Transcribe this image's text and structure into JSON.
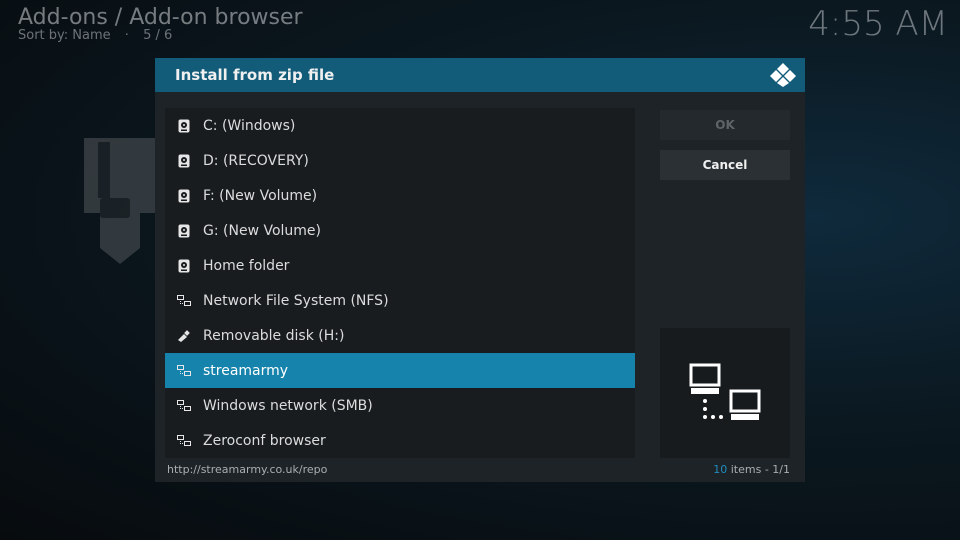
{
  "header": {
    "title": "Add-ons / Add-on browser",
    "sort_label": "Sort by: Name",
    "position": "5 / 6"
  },
  "clock": "4:55 AM",
  "dialog": {
    "title": "Install from zip file",
    "items": [
      {
        "label": "C: (Windows)",
        "icon": "hard-drive-icon"
      },
      {
        "label": "D: (RECOVERY)",
        "icon": "hard-drive-icon"
      },
      {
        "label": "F: (New Volume)",
        "icon": "hard-drive-icon"
      },
      {
        "label": "G: (New Volume)",
        "icon": "hard-drive-icon"
      },
      {
        "label": "Home folder",
        "icon": "hard-drive-icon"
      },
      {
        "label": "Network File System (NFS)",
        "icon": "network-icon"
      },
      {
        "label": "Removable disk (H:)",
        "icon": "usb-icon"
      },
      {
        "label": "streamarmy",
        "icon": "network-icon",
        "selected": true
      },
      {
        "label": "Windows network (SMB)",
        "icon": "network-icon"
      },
      {
        "label": "Zeroconf browser",
        "icon": "network-icon"
      }
    ],
    "ok_label": "OK",
    "cancel_label": "Cancel",
    "path": "http://streamarmy.co.uk/repo",
    "count_number": "10",
    "count_suffix": " items - 1/1"
  },
  "colors": {
    "accent": "#1583ab",
    "header": "#125c7a",
    "count": "#1f8cc0"
  }
}
